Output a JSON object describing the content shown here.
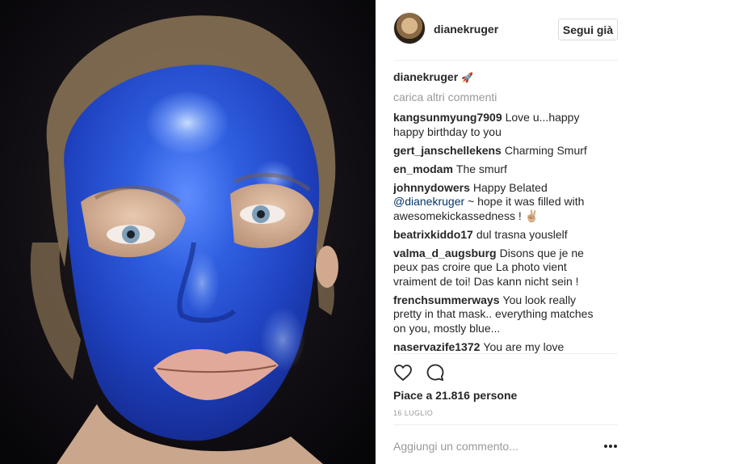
{
  "post": {
    "owner": "dianekruger",
    "follow_label": "Segui già",
    "caption_user": "dianekruger",
    "caption_emoji": "🚀",
    "load_more": "carica altri commenti",
    "comments": [
      {
        "user": "kangsunmyung7909",
        "text": "Love u...happy happy birthday to you"
      },
      {
        "user": "gert_janschellekens",
        "text": "Charming Smurf"
      },
      {
        "user": "en_modam",
        "text": "The smurf"
      },
      {
        "user": "johnnydowers",
        "text_before": "Happy Belated",
        "mention": "@dianekruger",
        "text_after": " ~ hope it was filled with awesomekickassedness ! ✌🏼"
      },
      {
        "user": "beatrixkiddo17",
        "text": "dul trasna youslelf"
      },
      {
        "user": "valma_d_augsburg",
        "text": "Disons que je ne peux pas croire que La photo vient vraiment de toi! Das kann nicht sein !"
      },
      {
        "user": "frenchsummerways",
        "text": "You look really pretty in that mask.. everything matches on you, mostly blue..."
      },
      {
        "user": "naservazife1372",
        "text": "You are my love"
      }
    ],
    "actions": {
      "like_icon": "heart-icon",
      "comment_icon": "comment-bubble-icon"
    },
    "likes": "Piace a 21.816 persone",
    "date": "16 LUGLIO",
    "comment_placeholder": "Aggiungi un commento...",
    "more_icon": "more-options-icon"
  },
  "colors": {
    "mask_blue": "#2c56d8",
    "text": "#262626",
    "muted": "#999999",
    "mention": "#003569"
  }
}
